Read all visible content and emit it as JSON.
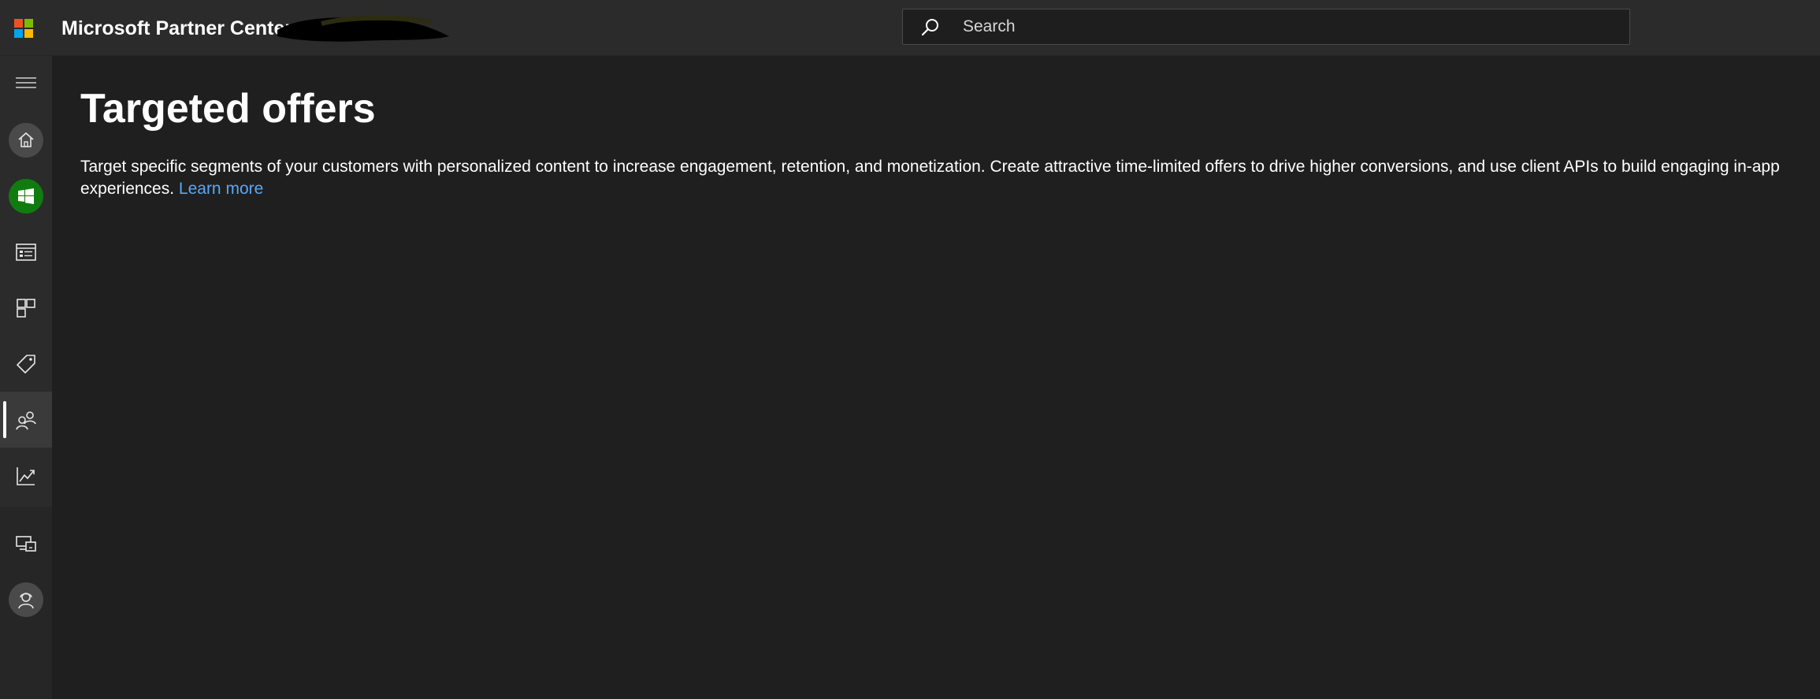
{
  "header": {
    "app_title": "Microsoft Partner Center",
    "logo_colors": [
      "#f25022",
      "#7fba00",
      "#00a4ef",
      "#ffb900"
    ],
    "search": {
      "placeholder": "Search",
      "value": ""
    }
  },
  "sidebar": {
    "items": [
      {
        "name": "menu",
        "icon": "hamburger-menu-icon"
      },
      {
        "name": "home",
        "icon": "home-icon"
      },
      {
        "name": "windows",
        "icon": "windows-icon"
      },
      {
        "name": "overview",
        "icon": "list-card-icon"
      },
      {
        "name": "apps",
        "icon": "grid-icon"
      },
      {
        "name": "offers",
        "icon": "tag-icon"
      },
      {
        "name": "customers",
        "icon": "people-icon",
        "active": true
      },
      {
        "name": "analytics",
        "icon": "chart-icon"
      },
      {
        "name": "devices",
        "icon": "devices-icon"
      },
      {
        "name": "account",
        "icon": "support-person-icon"
      }
    ],
    "accent_green": "#107c10"
  },
  "main": {
    "title": "Targeted offers",
    "description": "Target specific segments of your customers with personalized content to increase engagement, retention, and monetization. Create attractive time-limited offers to drive higher conversions, and use client APIs to build engaging in-app experiences. ",
    "learn_more": "Learn more",
    "link_color": "#5aa7f5"
  }
}
